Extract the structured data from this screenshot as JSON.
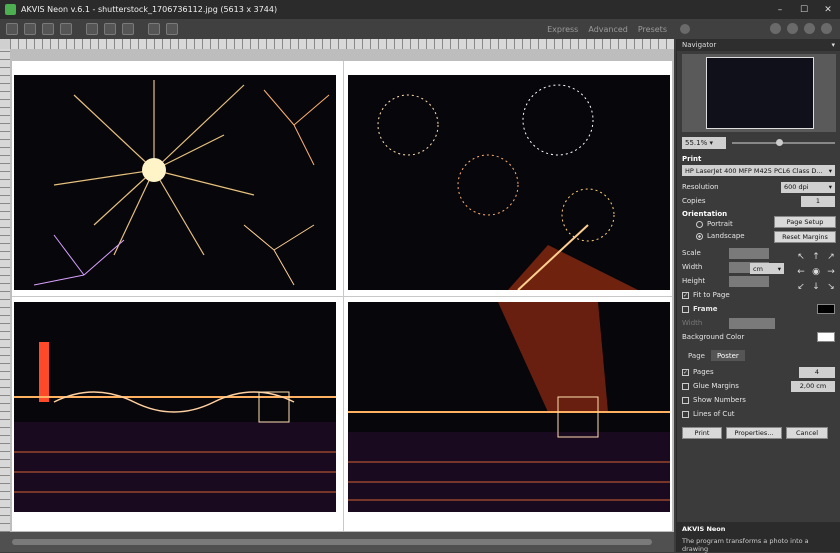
{
  "window": {
    "title": "AKVIS Neon v.6.1 - shutterstock_1706736112.jpg (5613 x 3744)",
    "minimize": "–",
    "maximize": "☐",
    "close": "✕"
  },
  "toolbar": {
    "modes": [
      "Express",
      "Advanced",
      "Presets"
    ]
  },
  "navigator": {
    "title": "Navigator",
    "zoom": "55.1%"
  },
  "print": {
    "title": "Print",
    "printer": "HP LaserJet 400 MFP M425 PCL6 Class D...",
    "resolution_label": "Resolution",
    "resolution_value": "600 dpi",
    "copies_label": "Copies",
    "copies_value": "1",
    "orientation_label": "Orientation",
    "portrait_label": "Portrait",
    "landscape_label": "Landscape",
    "page_setup": "Page Setup",
    "reset_margins": "Reset Margins",
    "scale_label": "Scale",
    "width_label": "Width",
    "height_label": "Height",
    "unit": "cm",
    "fit_to_page": "Fit to Page",
    "frame": "Frame",
    "frame_width_label": "Width",
    "background_color": "Background Color"
  },
  "tabs": {
    "page": "Page",
    "poster": "Poster"
  },
  "poster": {
    "pages_label": "Pages",
    "pages_value": "4",
    "glue_margins_label": "Glue Margins",
    "glue_margins_value": "2,00 cm",
    "show_numbers": "Show Numbers",
    "lines_of_cut": "Lines of Cut"
  },
  "actions": {
    "print": "Print",
    "properties": "Properties...",
    "cancel": "Cancel"
  },
  "info": {
    "title": "AKVIS Neon",
    "text": "The program transforms a photo into a drawing"
  }
}
